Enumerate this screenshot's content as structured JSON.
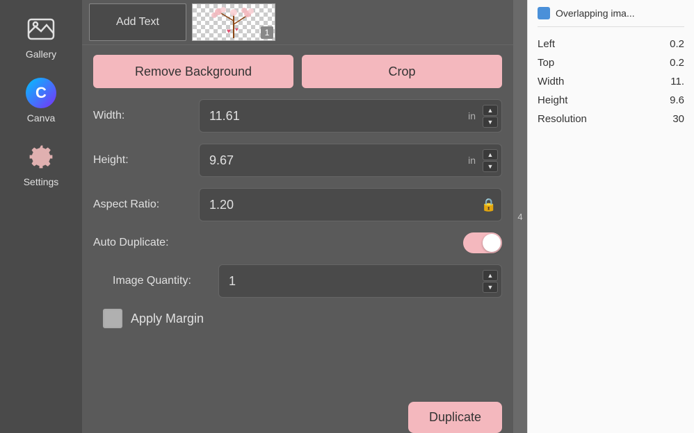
{
  "sidebar": {
    "items": [
      {
        "id": "gallery",
        "label": "Gallery"
      },
      {
        "id": "canva",
        "label": "Canva"
      },
      {
        "id": "settings",
        "label": "Settings"
      }
    ]
  },
  "topStrip": {
    "addTextLabel": "Add Text",
    "thumbnailBadge": "1"
  },
  "actions": {
    "removeBackground": "Remove Background",
    "crop": "Crop"
  },
  "fields": {
    "widthLabel": "Width:",
    "widthValue": "11.61",
    "widthUnit": "in",
    "heightLabel": "Height:",
    "heightValue": "9.67",
    "heightUnit": "in",
    "aspectRatioLabel": "Aspect Ratio:",
    "aspectRatioValue": "1.20",
    "autoDuplicateLabel": "Auto Duplicate:",
    "imageQuantityLabel": "Image Quantity:",
    "imageQuantityValue": "1",
    "applyMarginLabel": "Apply Margin"
  },
  "duplicateBtn": "Duplicate",
  "rightPanel": {
    "overlappingLabel": "Overlapping ima...",
    "properties": [
      {
        "key": "Left",
        "value": "0.2"
      },
      {
        "key": "Top",
        "value": "0.2"
      },
      {
        "key": "Width",
        "value": "11."
      },
      {
        "key": "Height",
        "value": "9.6"
      },
      {
        "key": "Resolution",
        "value": "30"
      }
    ]
  },
  "vSeparatorNumber": "4"
}
